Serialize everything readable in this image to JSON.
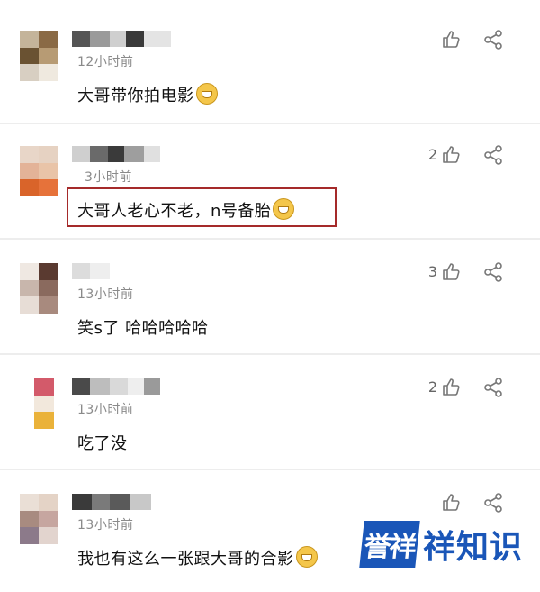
{
  "comments": [
    {
      "time": "12小时前",
      "text": "大哥带你拍电影",
      "likes": "",
      "emoji": "grinning-emoji"
    },
    {
      "time": "3小时前",
      "text": "大哥人老心不老，n号备胎",
      "likes": "2",
      "emoji": "doge-emoji"
    },
    {
      "time": "13小时前",
      "text": "笑s了 哈哈哈哈哈",
      "likes": "3",
      "emoji": ""
    },
    {
      "time": "13小时前",
      "text": "吃了没",
      "likes": "2",
      "emoji": ""
    },
    {
      "time": "13小时前",
      "text": "我也有这么一张跟大哥的合影",
      "likes": "",
      "emoji": "doge-emoji"
    }
  ],
  "watermark": {
    "logo": "誉祥",
    "text": "祥知识"
  },
  "colors": {
    "highlight": "#a52a2a",
    "brand": "#1a56b8",
    "icon": "#777777"
  }
}
